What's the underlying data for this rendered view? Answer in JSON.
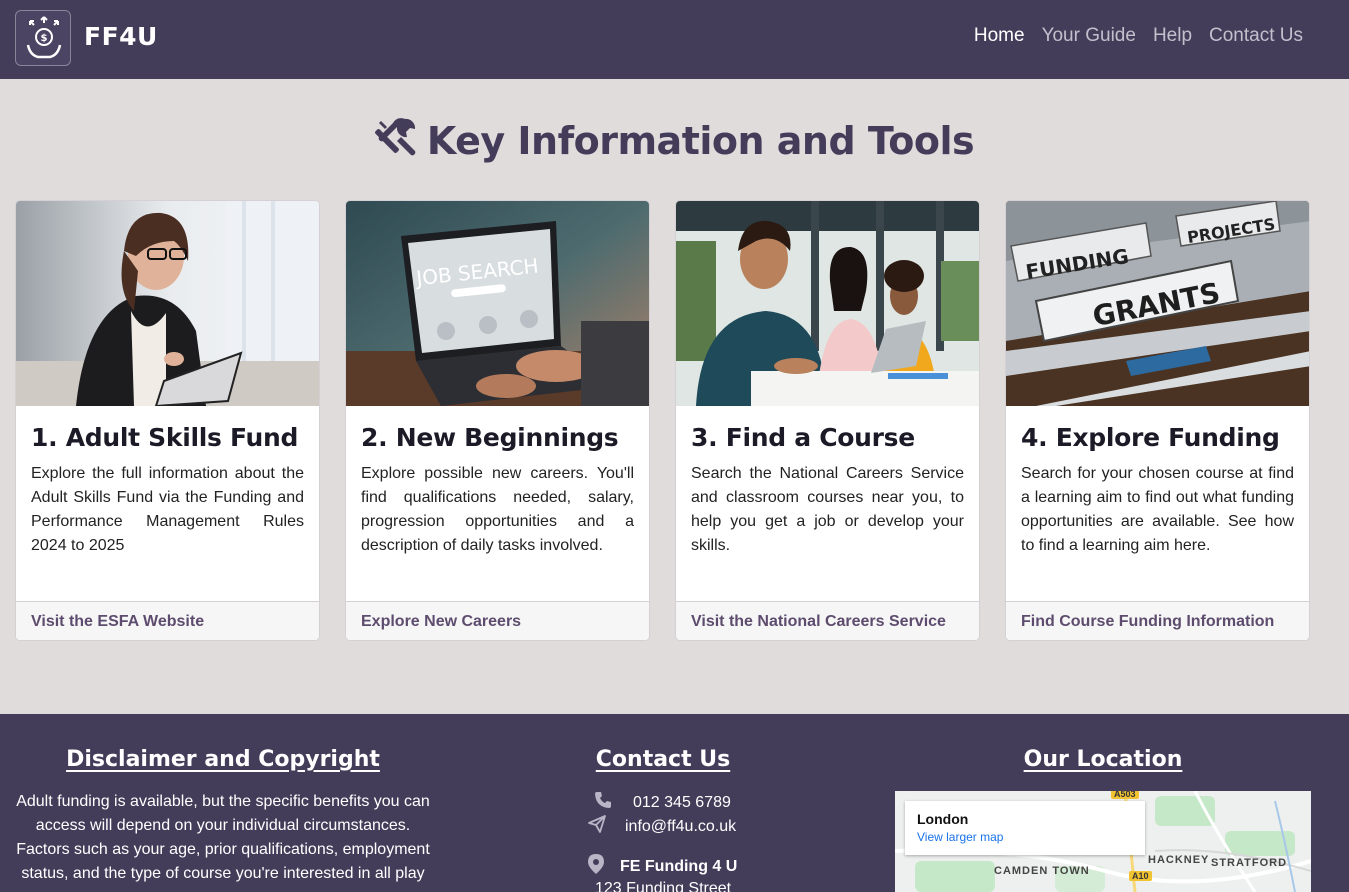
{
  "header": {
    "logo_text": "FF4U",
    "nav": [
      {
        "label": "Home",
        "active": true
      },
      {
        "label": "Your Guide",
        "active": false
      },
      {
        "label": "Help",
        "active": false
      },
      {
        "label": "Contact Us",
        "active": false
      }
    ]
  },
  "main": {
    "title": "Key Information and Tools",
    "title_icon": "tools-icon",
    "cards": [
      {
        "image": "woman-with-clipboard-photo",
        "title": "1. Adult Skills Fund",
        "text": "Explore the full information about the Adult Skills Fund via the Funding and Performance Management Rules 2024 to 2025",
        "link": "Visit the ESFA Website"
      },
      {
        "image": "laptop-job-search-photo",
        "image_text": "JOB SEARCH",
        "title": "2. New Beginnings",
        "text": "Explore possible new careers. You'll find qualifications needed, salary, progression opportunities and a description of daily tasks involved.",
        "link": "Explore New Careers"
      },
      {
        "image": "students-in-classroom-photo",
        "title": "3. Find a Course",
        "text": "Search the National Careers Service and classroom courses near you, to help you get a job or develop your skills.",
        "link": "Visit the National Careers Service"
      },
      {
        "image": "funding-grants-folders-photo",
        "image_text": [
          "FUNDING",
          "PROJECTS",
          "GRANTS"
        ],
        "title": "4. Explore Funding",
        "text": "Search for your chosen course at find a learning aim to find out what funding opportunities are available. See how to find a learning aim here.",
        "link": "Find Course Funding Information"
      }
    ]
  },
  "footer": {
    "disclaimer": {
      "heading": "Disclaimer and Copyright",
      "text": "Adult funding is available, but the specific benefits you can access will depend on your individual circumstances. Factors such as your age, prior qualifications, employment status, and the type of course you're interested in all play"
    },
    "contact": {
      "heading": "Contact Us",
      "phone": "012 345 6789",
      "email": "info@ff4u.co.uk",
      "org": "FE Funding 4 U",
      "street": "123 Funding Street"
    },
    "location": {
      "heading": "Our Location",
      "map_city": "London",
      "map_link": "View larger map",
      "map_labels": [
        "HACKNEY",
        "STRATFORD",
        "CAMDEN TOWN"
      ],
      "road_badges": [
        "A503",
        "A10"
      ]
    }
  },
  "colors": {
    "header_bg": "#443d5a",
    "page_bg": "#e0dcdc",
    "link": "#5e4c6e"
  }
}
